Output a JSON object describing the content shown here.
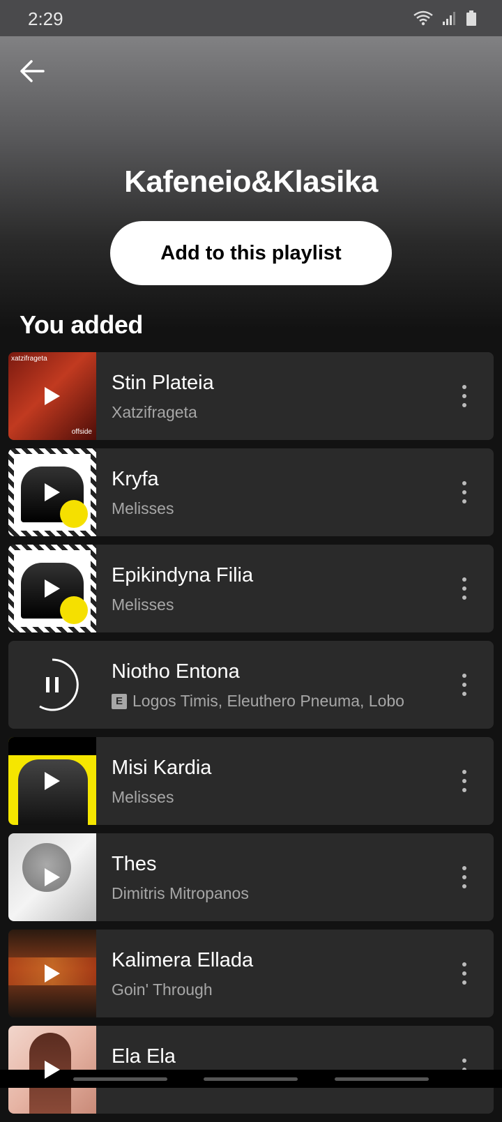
{
  "status": {
    "time": "2:29"
  },
  "header": {
    "title": "Kafeneio&Klasika",
    "add_button": "Add to this playlist"
  },
  "section": {
    "title": "You added"
  },
  "tracks": [
    {
      "title": "Stin Plateia",
      "artist": "Xatzifrageta",
      "explicit": false,
      "playing": false
    },
    {
      "title": "Kryfa",
      "artist": "Melisses",
      "explicit": false,
      "playing": false
    },
    {
      "title": "Epikindyna Filia",
      "artist": "Melisses",
      "explicit": false,
      "playing": false
    },
    {
      "title": "Niotho Entona",
      "artist": "Logos Timis, Eleuthero Pneuma, Lobo",
      "explicit": true,
      "explicit_label": "E",
      "playing": true
    },
    {
      "title": "Misi Kardia",
      "artist": "Melisses",
      "explicit": false,
      "playing": false
    },
    {
      "title": "Thes",
      "artist": "Dimitris Mitropanos",
      "explicit": false,
      "playing": false
    },
    {
      "title": "Kalimera Ellada",
      "artist": "Goin' Through",
      "explicit": false,
      "playing": false
    },
    {
      "title": "Ela Ela",
      "artist": "",
      "explicit": false,
      "playing": false
    }
  ],
  "colors": {
    "background": "#121212",
    "row": "#2a2a2a",
    "subtext": "#a7a7a7"
  }
}
